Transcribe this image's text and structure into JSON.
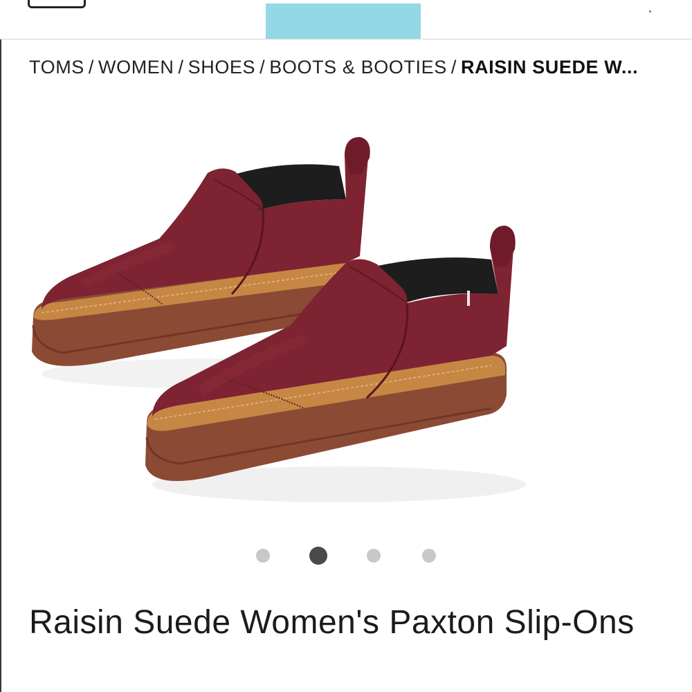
{
  "header": {
    "menu_icon": "menu-icon",
    "promo_color": "#94d8e6"
  },
  "breadcrumb": {
    "items": [
      "TOMS",
      "WOMEN",
      "SHOES",
      "BOOTS & BOOTIES"
    ],
    "separator": "/",
    "current": "RAISIN SUEDE W..."
  },
  "product": {
    "image_icon": "boots-product-image",
    "title": "Raisin Suede Women's Paxton Slip-Ons",
    "colors": {
      "suede": "#7e2331",
      "sole": "#8b4a34",
      "trim": "#c68745",
      "lining": "#1d1d1d"
    }
  },
  "carousel": {
    "count": 4,
    "active_index": 1
  }
}
